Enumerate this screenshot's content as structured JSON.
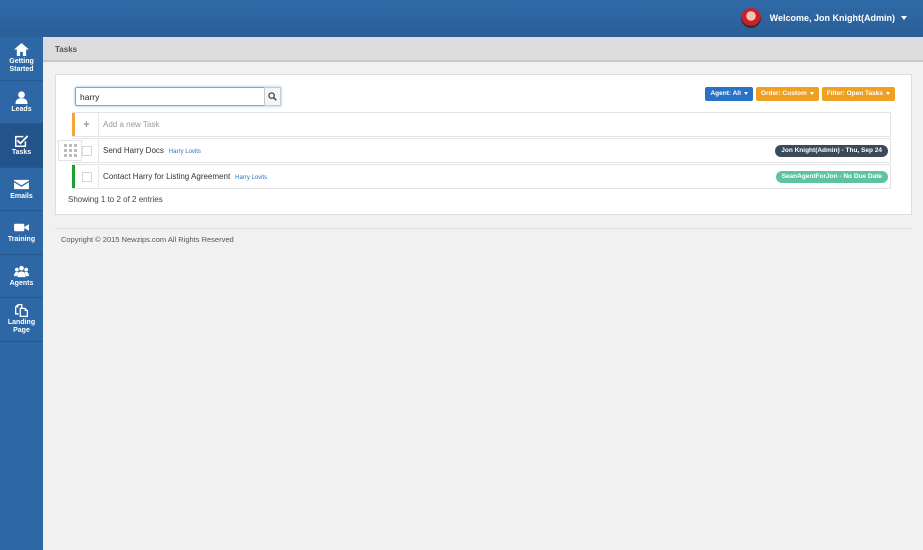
{
  "header": {
    "welcome": "Welcome, Jon Knight(Admin)",
    "avatar_icon": "user-avatar"
  },
  "sidebar": {
    "items": [
      {
        "label_line1": "Getting",
        "label_line2": "Started",
        "icon": "home-icon",
        "active": false
      },
      {
        "label_line1": "Leads",
        "label_line2": "",
        "icon": "user-icon",
        "active": false
      },
      {
        "label_line1": "Tasks",
        "label_line2": "",
        "icon": "checkbox-icon",
        "active": true
      },
      {
        "label_line1": "Emails",
        "label_line2": "",
        "icon": "envelope-icon",
        "active": false
      },
      {
        "label_line1": "Training",
        "label_line2": "",
        "icon": "video-camera-icon",
        "active": false
      },
      {
        "label_line1": "Agents",
        "label_line2": "",
        "icon": "group-icon",
        "active": false
      },
      {
        "label_line1": "Landing",
        "label_line2": "Page",
        "icon": "copy-pages-icon",
        "active": false
      }
    ]
  },
  "page": {
    "title": "Tasks"
  },
  "search": {
    "value": "harry",
    "icon": "search-icon"
  },
  "filters": {
    "agent": "Agent: All",
    "order": "Order: Custom",
    "filter": "Filter: Open Tasks"
  },
  "new_task": {
    "plus": "+",
    "placeholder": "Add a new Task"
  },
  "tasks": [
    {
      "title": "Send Harry Docs",
      "lead": "Harry Lovits",
      "due": "Jon Knight(Admin) - Thu, Sep 24",
      "bar_color": "#ffffff",
      "due_color": "#3b4a59"
    },
    {
      "title": "Contact Harry for Listing Agreement",
      "lead": "Harry Lovits",
      "due": "SeanAgentForJon - No Due Date",
      "bar_color": "#1e9e2f",
      "due_color": "#5ec3a2"
    }
  ],
  "new_task_bar_color": "#f3a43a",
  "entries_text": "Showing 1 to 2 of 2 entries",
  "footer": {
    "copyright": "Copyright © 2015 Newzips.com All Rights Reserved"
  }
}
